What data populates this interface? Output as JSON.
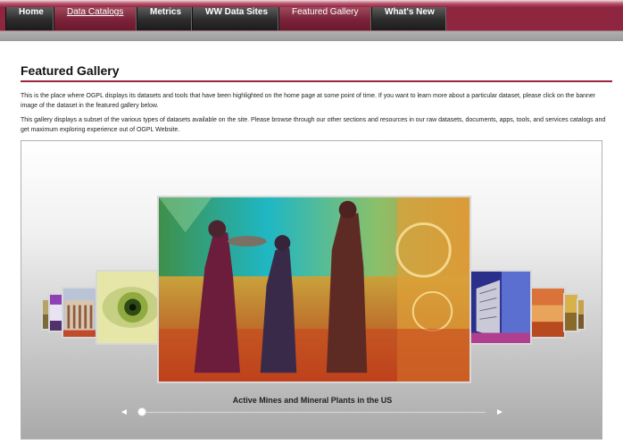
{
  "nav": {
    "items": [
      {
        "label": "Home"
      },
      {
        "label": "Data Catalogs"
      },
      {
        "label": "Metrics"
      },
      {
        "label": "WW Data Sites"
      },
      {
        "label": "Featured Gallery"
      },
      {
        "label": "What's New"
      }
    ]
  },
  "page": {
    "title": "Featured Gallery",
    "paragraph1": "This is the place where OGPL displays its datasets and tools that have been highlighted on the home page at some point of time. If you want to learn more about a particular dataset, please click on the banner image of the dataset in the featured gallery below.",
    "paragraph2": "This gallery displays a subset of the various types of datasets available on the site. Please browse through our other sections and resources in our raw datasets, documents, apps, tools, and services catalogs and get maximum exploring experience out of OGPL Website."
  },
  "gallery": {
    "caption": "Active Mines and Mineral Plants in the US",
    "prev_icon": "arrow-left-icon",
    "next_icon": "arrow-right-icon",
    "slider_value": 0
  },
  "colors": {
    "brand_maroon": "#8f2640",
    "nav_dark": "#2c2c2c",
    "rule": "#9c2540"
  }
}
